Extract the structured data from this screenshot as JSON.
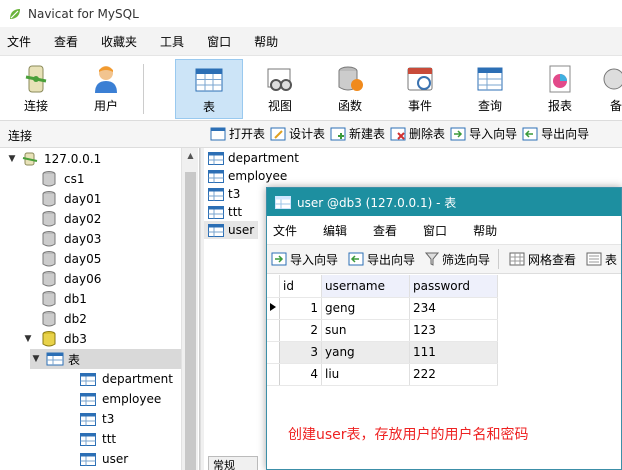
{
  "app": {
    "title": "Navicat for MySQL"
  },
  "menubar": [
    "文件",
    "查看",
    "收藏夹",
    "工具",
    "窗口",
    "帮助"
  ],
  "toolbar": [
    {
      "label": "连接",
      "icon": "connection-icon"
    },
    {
      "label": "用户",
      "icon": "user-icon"
    },
    {
      "label": "表",
      "icon": "table-icon",
      "active": true
    },
    {
      "label": "视图",
      "icon": "view-icon"
    },
    {
      "label": "函数",
      "icon": "function-icon"
    },
    {
      "label": "事件",
      "icon": "event-icon"
    },
    {
      "label": "查询",
      "icon": "query-icon"
    },
    {
      "label": "报表",
      "icon": "report-icon"
    },
    {
      "label": "备",
      "icon": "backup-icon"
    }
  ],
  "subbar": {
    "connection_label": "连接",
    "actions": [
      "打开表",
      "设计表",
      "新建表",
      "删除表",
      "导入向导",
      "导出向导"
    ]
  },
  "tree": {
    "server": "127.0.0.1",
    "databases": [
      "cs1",
      "day01",
      "day02",
      "day03",
      "day05",
      "day06",
      "db1",
      "db2",
      "db3"
    ],
    "db3_folder": "表",
    "db3_tables": [
      "department",
      "employee",
      "t3",
      "ttt",
      "user"
    ]
  },
  "objects": [
    "department",
    "employee",
    "t3",
    "ttt",
    "user"
  ],
  "bottom_tab": "常规",
  "window": {
    "title": "user @db3 (127.0.0.1) - 表",
    "menu": [
      "文件",
      "编辑",
      "查看",
      "窗口",
      "帮助"
    ],
    "tools": [
      "导入向导",
      "导出向导",
      "筛选向导",
      "网格查看",
      "表"
    ],
    "columns": [
      "id",
      "username",
      "password"
    ],
    "rows": [
      {
        "id": "1",
        "username": "geng",
        "password": "234"
      },
      {
        "id": "2",
        "username": "sun",
        "password": "123"
      },
      {
        "id": "3",
        "username": "yang",
        "password": "111"
      },
      {
        "id": "4",
        "username": "liu",
        "password": "222"
      }
    ]
  },
  "annotation": "创建user表，存放用户的用户名和密码",
  "colors": {
    "window_title": "#1d8fa0",
    "selection": "#cce4f7",
    "annotation": "#ee2222"
  }
}
